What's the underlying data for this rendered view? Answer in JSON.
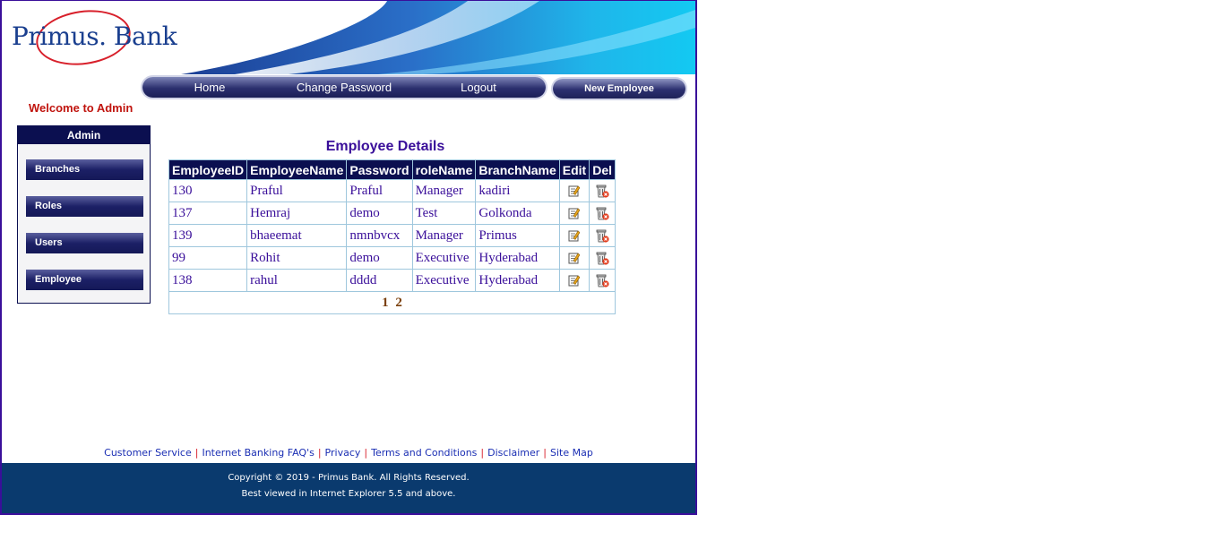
{
  "brand": {
    "logo_text": "Primus. Bank"
  },
  "nav": {
    "home": "Home",
    "change_password": "Change Password",
    "logout": "Logout",
    "new_employee": "New Employee"
  },
  "welcome": "Welcome to Admin",
  "sidebar": {
    "title": "Admin",
    "items": [
      {
        "label": "Branches"
      },
      {
        "label": "Roles"
      },
      {
        "label": "Users"
      },
      {
        "label": "Employee"
      }
    ]
  },
  "table": {
    "title": "Employee Details",
    "headers": [
      "EmployeeID",
      "EmployeeName",
      "Password",
      "roleName",
      "BranchName",
      "Edit",
      "Del"
    ],
    "rows": [
      [
        "130",
        "Praful",
        "Praful",
        "Manager",
        "kadiri"
      ],
      [
        "137",
        "Hemraj",
        "demo",
        "Test",
        "Golkonda"
      ],
      [
        "139",
        "bhaeemat",
        "nmnbvcx",
        "Manager",
        "Primus"
      ],
      [
        "99",
        "Rohit",
        "demo",
        "Executive",
        "Hyderabad"
      ],
      [
        "138",
        "rahul",
        "dddd",
        "Executive",
        "Hyderabad"
      ]
    ],
    "pages": [
      "1",
      "2"
    ]
  },
  "footer_links": [
    "Customer Service",
    "Internet Banking FAQ's",
    "Privacy",
    "Terms and Conditions",
    "Disclaimer",
    "Site Map"
  ],
  "copyright": "Copyright © 2019 - Primus Bank. All Rights Reserved.",
  "browser_note": "Best viewed in Internet Explorer 5.5 and above.",
  "colors": {
    "nav_dark": "#1b1f57",
    "accent": "#3a0f9a",
    "welcome": "#c0140e",
    "footer_bg": "#0a3a6e"
  }
}
